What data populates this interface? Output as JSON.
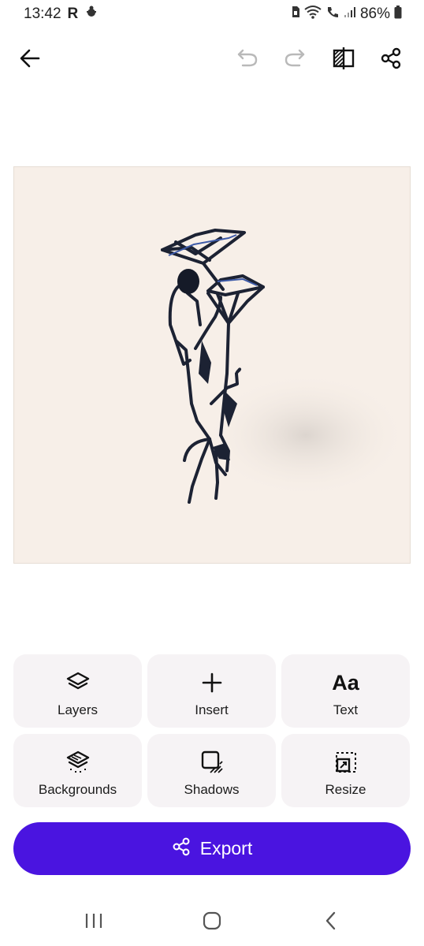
{
  "status_bar": {
    "time": "13:42",
    "app_indicator": "R",
    "battery": "86%",
    "icons": [
      "notification-bug-icon",
      "sim-icon",
      "wifi-icon",
      "call-icon",
      "signal-icon",
      "battery-icon"
    ]
  },
  "toolbar": {
    "back": "arrow-left-icon",
    "undo": "undo-icon",
    "redo": "redo-icon",
    "compare": "compare-icon",
    "share": "share-icon"
  },
  "canvas": {
    "background": "#f7efe8",
    "content": "sculpture-image"
  },
  "tools": [
    {
      "label": "Layers",
      "icon": "layers-icon"
    },
    {
      "label": "Insert",
      "icon": "plus-icon"
    },
    {
      "label": "Text",
      "icon": "text-icon",
      "glyph": "Aa"
    },
    {
      "label": "Backgrounds",
      "icon": "backgrounds-icon"
    },
    {
      "label": "Shadows",
      "icon": "shadows-icon"
    },
    {
      "label": "Resize",
      "icon": "resize-icon"
    }
  ],
  "export": {
    "label": "Export",
    "color": "#4a14e0",
    "icon": "share-icon"
  },
  "nav": {
    "recents": "recents-icon",
    "home": "home-icon",
    "back": "back-chevron-icon"
  }
}
